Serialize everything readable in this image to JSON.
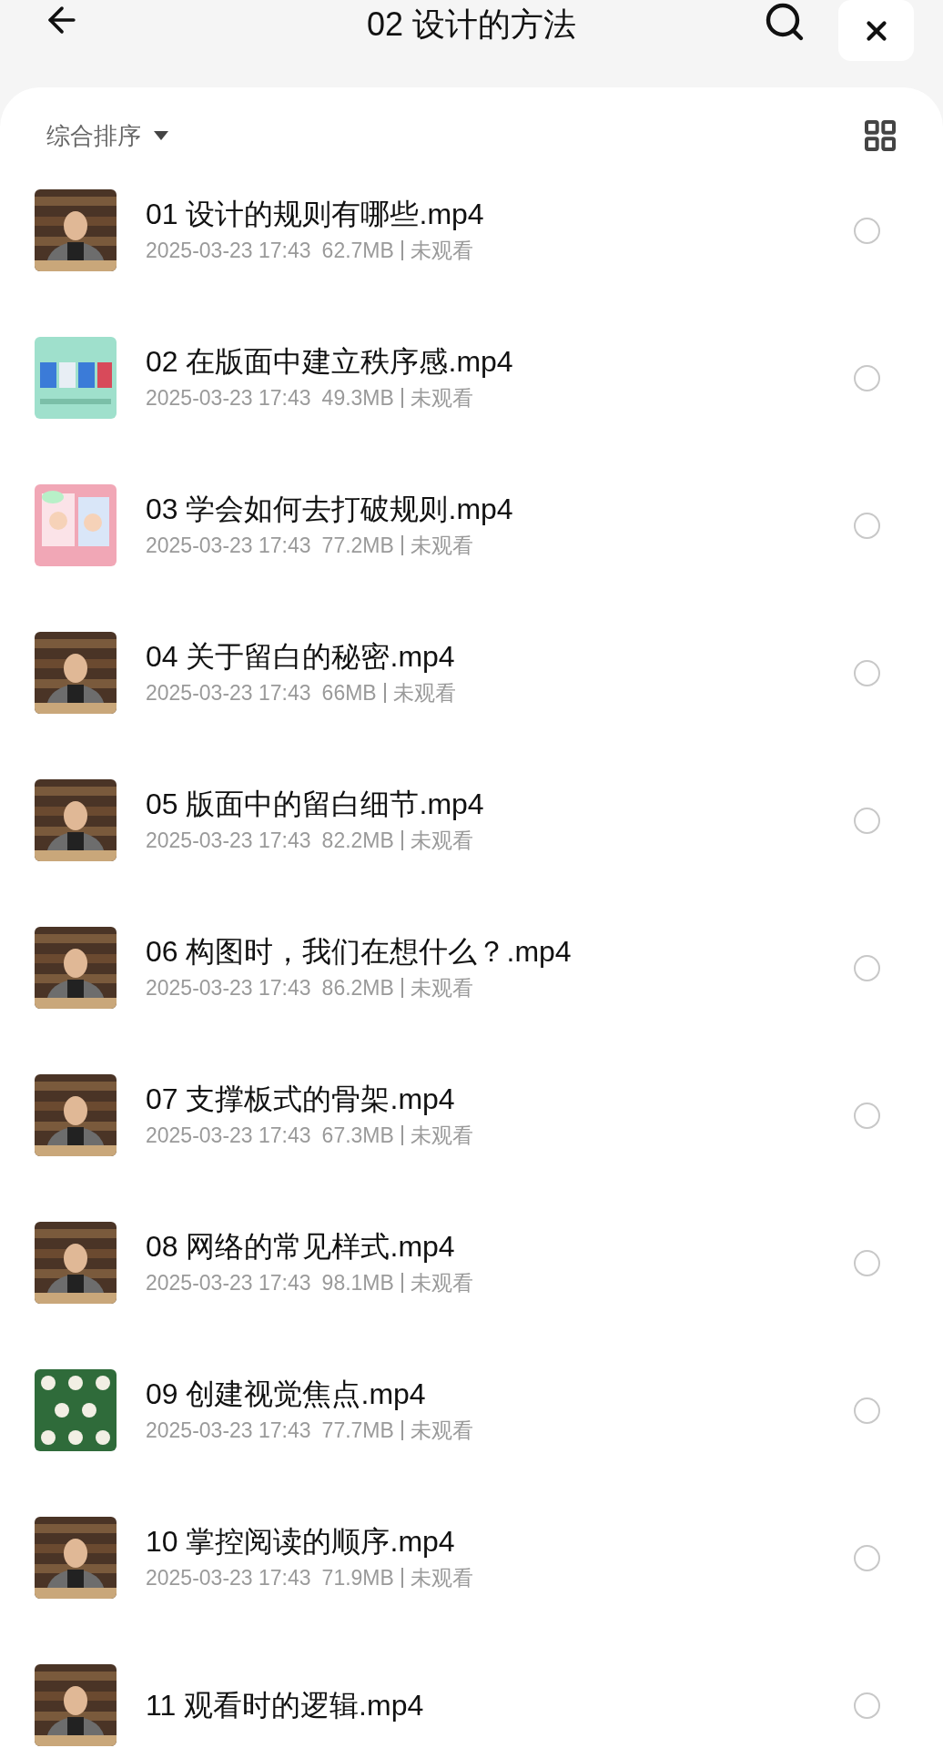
{
  "header": {
    "title": "02 设计的方法"
  },
  "toolbar": {
    "sort_label": "综合排序"
  },
  "files": [
    {
      "title": "01 设计的规则有哪些.mp4",
      "date": "2025-03-23 17:43",
      "size": "62.7MB",
      "status": "未观看",
      "selected": false
    },
    {
      "title": "02 在版面中建立秩序感.mp4",
      "date": "2025-03-23 17:43",
      "size": "49.3MB",
      "status": "未观看",
      "selected": false
    },
    {
      "title": "03 学会如何去打破规则.mp4",
      "date": "2025-03-23 17:43",
      "size": "77.2MB",
      "status": "未观看",
      "selected": false
    },
    {
      "title": "04 关于留白的秘密.mp4",
      "date": "2025-03-23 17:43",
      "size": "66MB",
      "status": "未观看",
      "selected": false
    },
    {
      "title": "05 版面中的留白细节.mp4",
      "date": "2025-03-23 17:43",
      "size": "82.2MB",
      "status": "未观看",
      "selected": false
    },
    {
      "title": "06 构图时，我们在想什么？.mp4",
      "date": "2025-03-23 17:43",
      "size": "86.2MB",
      "status": "未观看",
      "selected": false
    },
    {
      "title": "07 支撑板式的骨架.mp4",
      "date": "2025-03-23 17:43",
      "size": "67.3MB",
      "status": "未观看",
      "selected": false
    },
    {
      "title": "08 网络的常见样式.mp4",
      "date": "2025-03-23 17:43",
      "size": "98.1MB",
      "status": "未观看",
      "selected": false
    },
    {
      "title": "09 创建视觉焦点.mp4",
      "date": "2025-03-23 17:43",
      "size": "77.7MB",
      "status": "未观看",
      "selected": false
    },
    {
      "title": "10 掌控阅读的顺序.mp4",
      "date": "2025-03-23 17:43",
      "size": "71.9MB",
      "status": "未观看",
      "selected": false
    },
    {
      "title": "11 观看时的逻辑.mp4",
      "selected": false
    }
  ]
}
